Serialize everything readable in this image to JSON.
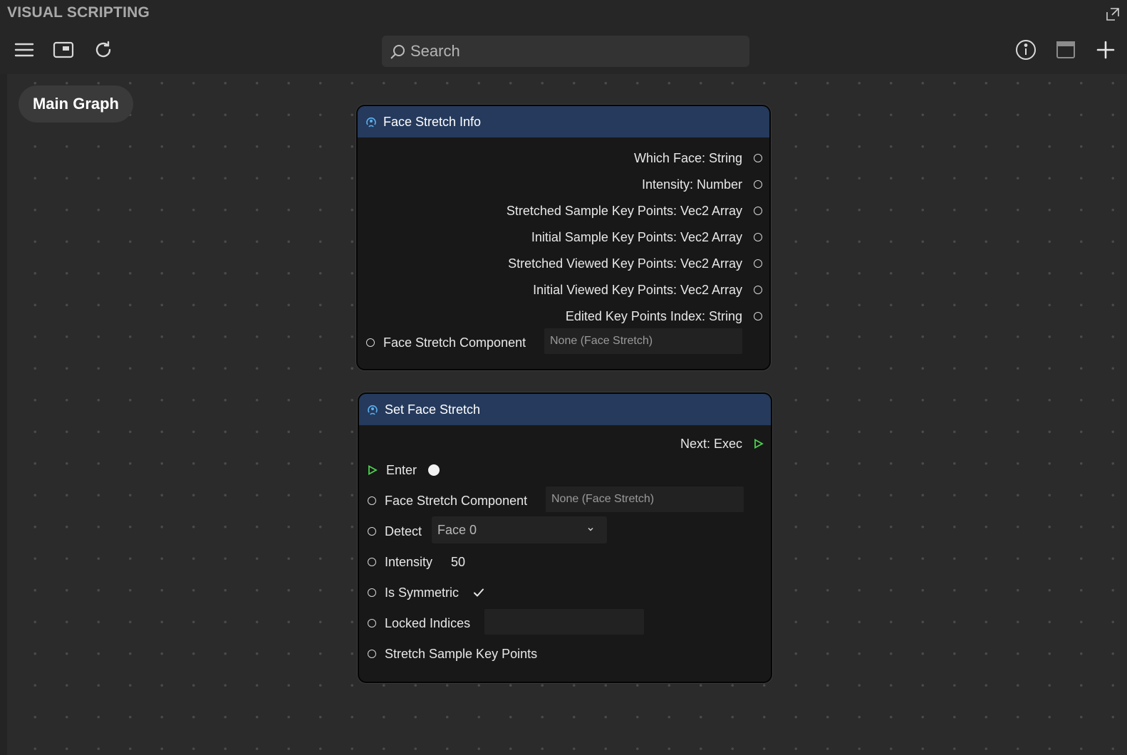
{
  "app": {
    "title": "VISUAL SCRIPTING"
  },
  "toolbar": {
    "icons": [
      "menu-icon",
      "panel-icon",
      "refresh-icon",
      "info-icon",
      "window-icon",
      "plus-icon"
    ],
    "search_placeholder": "Search"
  },
  "graph": {
    "breadcrumb": "Main Graph"
  },
  "node1": {
    "title": "Face Stretch Info",
    "outputs": [
      "Which Face: String",
      "Intensity: Number",
      "Stretched Sample Key Points: Vec2 Array",
      "Initial Sample Key Points: Vec2 Array",
      "Stretched Viewed Key Points: Vec2 Array",
      "Initial Viewed Key Points: Vec2 Array",
      "Edited Key Points Index: String"
    ],
    "input_label": "Face Stretch Component",
    "input_value": "None (Face Stretch)"
  },
  "node2": {
    "title": "Set Face Stretch",
    "next_label": "Next: Exec",
    "enter_label": "Enter",
    "component_label": "Face Stretch Component",
    "component_value": "None (Face Stretch)",
    "detect_label": "Detect",
    "detect_value": "Face 0",
    "intensity_label": "Intensity",
    "intensity_value": "50",
    "symmetric_label": "Is Symmetric",
    "symmetric_checked": true,
    "locked_label": "Locked Indices",
    "locked_value": "",
    "stretch_label": "Stretch Sample Key Points"
  },
  "colors": {
    "node_header": "#253a5c",
    "exec_green": "#4cd24c",
    "canvas": "#2b2b2b"
  }
}
